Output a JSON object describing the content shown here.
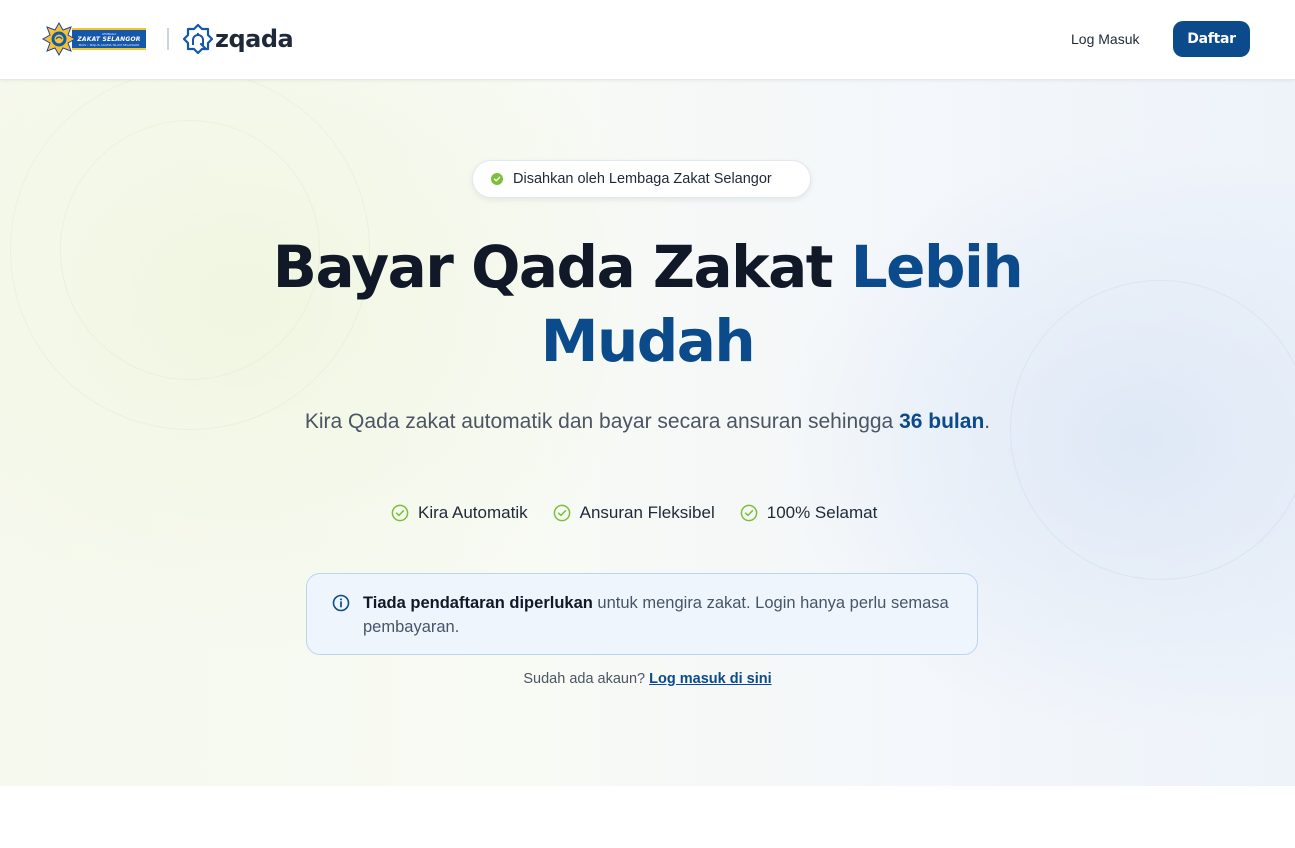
{
  "header": {
    "lzs_logo": {
      "line1": "LEMBAGA",
      "line2": "ZAKAT SELANGOR",
      "line3": "MAIS • MAJLIS AGAMA ISLAM SELANGOR"
    },
    "app_name": "zqada",
    "login_label": "Log Masuk",
    "signup_label": "Daftar"
  },
  "hero": {
    "badge": "Disahkan oleh Lembaga Zakat Selangor",
    "headline_dark": "Bayar Qada Zakat ",
    "headline_blue_1": "Lebih",
    "headline_blue_2": "Mudah",
    "subline_before": "Kira Qada zakat automatik dan bayar secara ansuran sehingga ",
    "subline_highlight": "36 bulan",
    "subline_after": ".",
    "features": [
      {
        "label": "Kira Automatik",
        "icon": "check-circle-icon"
      },
      {
        "label": "Ansuran Fleksibel",
        "icon": "check-circle-icon"
      },
      {
        "label": "100% Selamat",
        "icon": "check-circle-icon"
      }
    ],
    "notice": {
      "icon": "info-icon",
      "bold": "Tiada pendaftaran diperlukan",
      "rest": " untuk mengira zakat. Login hanya perlu semasa pembayaran."
    },
    "account_prompt": "Sudah ada akaun? ",
    "account_link": "Log masuk di sini"
  },
  "colors": {
    "brand_blue": "#0b4a8b",
    "check_green": "#7cbf3a",
    "notice_bg": "#eef5fd"
  }
}
